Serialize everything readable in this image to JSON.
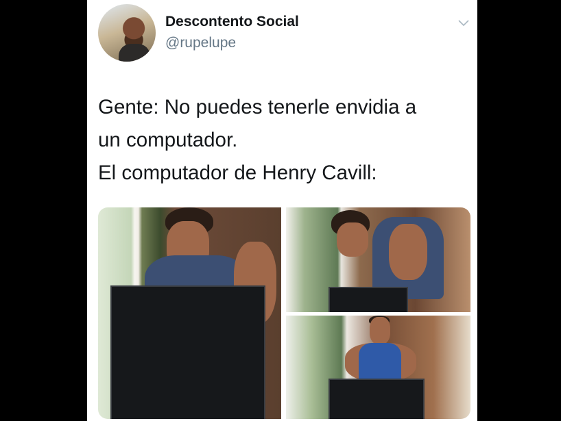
{
  "tweet": {
    "author": {
      "display_name": "Descontento Social",
      "handle": "@rupelupe"
    },
    "text_lines": [
      "Gente: No puedes tenerle envidia a",
      "un computador.",
      "El computador de Henry Cavill:"
    ]
  },
  "icons": {
    "more": "chevron-down-icon"
  }
}
